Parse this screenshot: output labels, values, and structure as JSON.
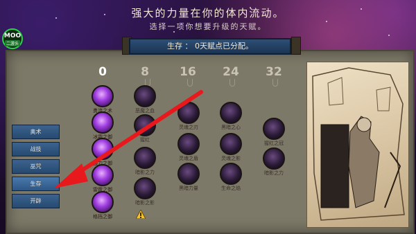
{
  "header": {
    "title": "强大的力量在你的体内流动。",
    "subtitle": "选择一项你想要升级的天赋。"
  },
  "logo": {
    "top": "MOO",
    "bottom": "二游头"
  },
  "banner": {
    "text": "生存 ： 0天赋点已分配。"
  },
  "tiers": [
    "0",
    "8",
    "16",
    "24",
    "32"
  ],
  "categories": [
    {
      "label": "奥术"
    },
    {
      "label": "战技"
    },
    {
      "label": "巫咒"
    },
    {
      "label": "生存"
    },
    {
      "label": "开辟"
    }
  ],
  "talents": {
    "col0": [
      "勇流之术",
      "冰霜之御",
      "强力之御",
      "雷霆之御",
      "格挡之御"
    ],
    "col1": [
      "恶魔之血",
      "猩红",
      "暗影之力",
      "暗影之影"
    ],
    "col2": [
      "灵魂之刃",
      "灵魂之盾",
      "黑暗力量"
    ],
    "col3": [
      "黑暗之心",
      "灵魂之影",
      "生命之焰"
    ],
    "col4": [
      "猩红之冠",
      "暗影之力"
    ]
  },
  "colors": {
    "accent_arrow": "#e8191d",
    "banner": "#2d4e75",
    "panel": "#7d7968"
  }
}
